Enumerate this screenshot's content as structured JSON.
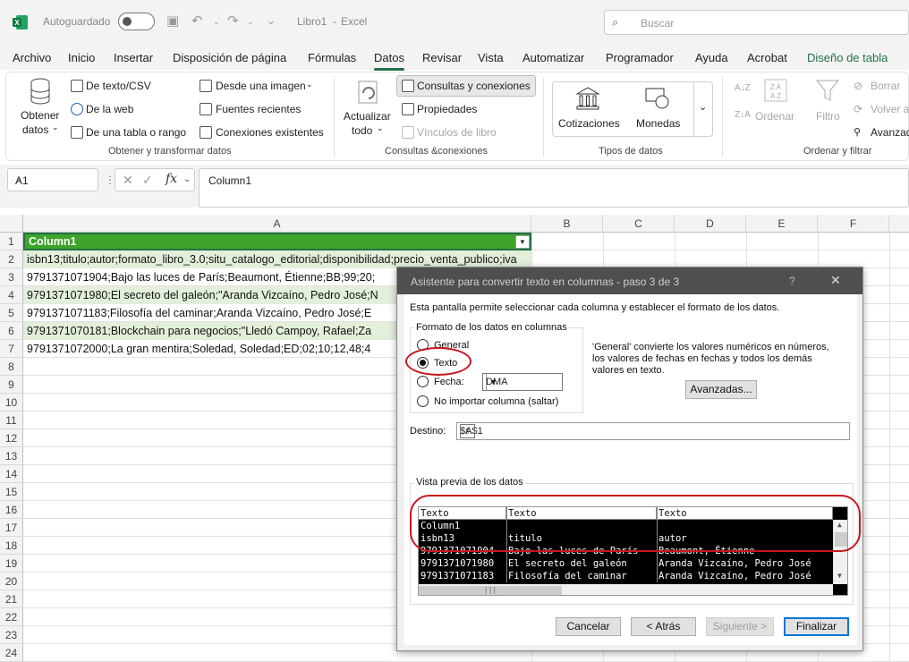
{
  "titlebar": {
    "autosave_label": "Autoguardado",
    "filename": "Libro1",
    "separator": "-",
    "app": "Excel",
    "search_placeholder": "Buscar"
  },
  "tabs": [
    "Archivo",
    "Inicio",
    "Insertar",
    "Disposición de página",
    "Fórmulas",
    "Datos",
    "Revisar",
    "Vista",
    "Automatizar",
    "Programador",
    "Ayuda",
    "Acrobat",
    "Diseño de tabla"
  ],
  "active_tab": "Datos",
  "ribbon": {
    "get_data": "Obtener",
    "get_data2": "datos",
    "from_text": "De texto/CSV",
    "from_web": "De la web",
    "from_table": "De una tabla o rango",
    "from_image": "Desde una imagen",
    "recent_sources": "Fuentes recientes",
    "existing_connections": "Conexiones existentes",
    "group1": "Obtener y transformar datos",
    "refresh": "Actualizar",
    "refresh2": "todo",
    "queries": "Consultas y conexiones",
    "properties": "Propiedades",
    "book_links": "Vínculos de libro",
    "group2": "Consultas &conexiones",
    "stocks": "Cotizaciones",
    "currencies": "Monedas",
    "group3": "Tipos de datos",
    "sort": "Ordenar",
    "filter": "Filtro",
    "clear": "Borrar",
    "reapply": "Volver a",
    "advanced": "Avanzad",
    "group4": "Ordenar y filtrar"
  },
  "formula_bar": {
    "name_box": "A1",
    "fx": "fx",
    "formula": "Column1"
  },
  "grid": {
    "columns": [
      "A",
      "B",
      "C",
      "D",
      "E",
      "F"
    ],
    "rows": [
      "1",
      "2",
      "3",
      "4",
      "5",
      "6",
      "7",
      "8",
      "9",
      "10",
      "11",
      "12",
      "13",
      "14",
      "15",
      "16",
      "17",
      "18",
      "19",
      "20",
      "21",
      "22",
      "23",
      "24"
    ],
    "cells": [
      "Column1",
      "isbn13;titulo;autor;formato_libro_3.0;situ_catalogo_editorial;disponibilidad;precio_venta_publico;iva",
      "9791371071904;Bajo las luces de París;Beaumont, Étienne;BB;99;20;",
      "9791371071980;El secreto del galeón;\"Aranda Vizcaíno, Pedro José;N",
      "9791371071183;Filosofía del caminar;Aranda Vizcaíno, Pedro José;E",
      "9791371070181;Blockchain para negocios;\"Lledó Campoy, Rafael;Za",
      "9791371072000;La gran mentira;Soledad, Soledad;ED;02;10;12,48;4"
    ]
  },
  "dialog": {
    "title": "Asistente para convertir texto en columnas - paso 3 de 3",
    "help": "?",
    "close": "✕",
    "intro": "Esta pantalla permite seleccionar cada columna y establecer el formato de los datos.",
    "format_group": "Formato de los datos en columnas",
    "opt_general": "General",
    "opt_text": "Texto",
    "opt_date": "Fecha:",
    "date_value": "DMA",
    "opt_skip": "No importar columna (saltar)",
    "desc1": "'General' convierte los valores numéricos en números,",
    "desc2": "los valores de fechas en fechas y todos los demás",
    "desc3": "valores en texto.",
    "advanced_btn": "Avanzadas...",
    "dest_label": "Destino:",
    "dest_value": "$A$1",
    "preview_label": "Vista previa de los datos",
    "preview_headers": [
      "Texto",
      "Texto",
      "Texto"
    ],
    "preview_rows": [
      [
        "Column1",
        "",
        ""
      ],
      [
        "isbn13",
        "titulo",
        "autor"
      ],
      [
        "9791371071904",
        "Bajo las luces de París",
        "Beaumont, Étienne"
      ],
      [
        "9791371071980",
        "El secreto del galeón",
        "Aranda Vizcaíno, Pedro José"
      ],
      [
        "9791371071183",
        "Filosofía del caminar",
        "Aranda Vizcaíno, Pedro José"
      ]
    ],
    "cancel": "Cancelar",
    "back": "< Atrás",
    "next": "Siguiente >",
    "finish": "Finalizar"
  },
  "colors": {
    "excel_green": "#217346",
    "table_header": "#3ea32a",
    "band": "#e2efda",
    "annotation": "#c8171e"
  }
}
